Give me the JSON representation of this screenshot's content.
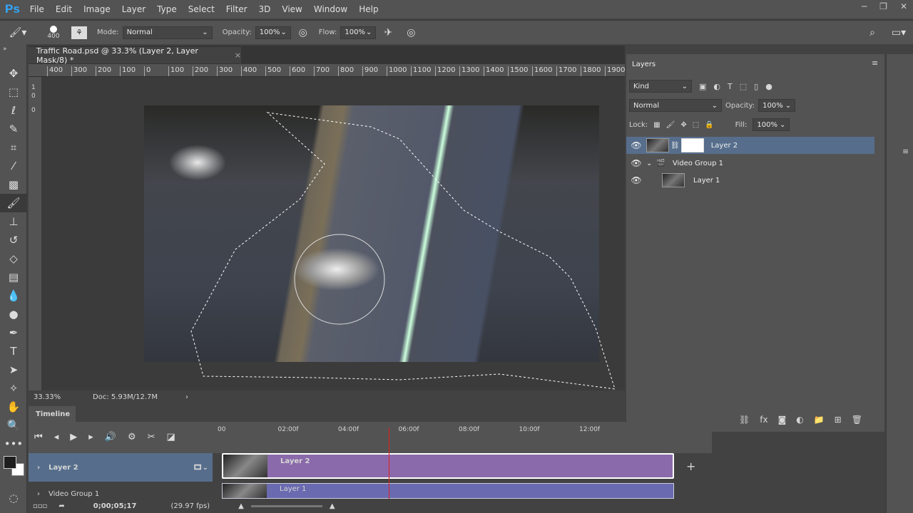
{
  "app": {
    "logo": "Ps",
    "menu": [
      "File",
      "Edit",
      "Image",
      "Layer",
      "Type",
      "Select",
      "Filter",
      "3D",
      "View",
      "Window",
      "Help"
    ]
  },
  "options": {
    "brush_size": "400",
    "mode_label": "Mode:",
    "mode": "Normal",
    "opacity_label": "Opacity:",
    "opacity": "100%",
    "flow_label": "Flow:",
    "flow": "100%"
  },
  "document": {
    "tab_title": "Traffic Road.psd @ 33.3% (Layer 2, Layer Mask/8) *",
    "ruler": [
      "400",
      "300",
      "200",
      "100",
      "0",
      "100",
      "200",
      "300",
      "400",
      "500",
      "600",
      "700",
      "800",
      "900",
      "1000",
      "1100",
      "1200",
      "1300",
      "1400",
      "1500",
      "1600",
      "1700",
      "1800",
      "1900"
    ],
    "ruler_left": [
      "1",
      "0",
      "0"
    ]
  },
  "status": {
    "zoom": "33.33%",
    "doc": "Doc: 5.93M/12.7M"
  },
  "timeline": {
    "tab": "Timeline",
    "ticks": [
      "00",
      "02:00f",
      "04:00f",
      "06:00f",
      "08:00f",
      "10:00f",
      "12:00f"
    ],
    "tracks": [
      "Layer 2",
      "Video Group 1"
    ],
    "clips": [
      {
        "label": "Layer 2",
        "color": "#8a6aaa"
      },
      {
        "label": "Layer 1",
        "color": "#6a6ab0"
      }
    ],
    "timecode": "0;00;05;17",
    "fps": "(29.97 fps)",
    "playhead_seconds": 5.57
  },
  "layers": {
    "tab": "Layers",
    "filter": "Kind",
    "blend": "Normal",
    "opacity_label": "Opacity:",
    "opacity": "100%",
    "lock_label": "Lock:",
    "fill_label": "Fill:",
    "fill": "100%",
    "items": [
      "Layer 2",
      "Video Group 1",
      "Layer 1"
    ],
    "selected_color": "#566e8c"
  }
}
